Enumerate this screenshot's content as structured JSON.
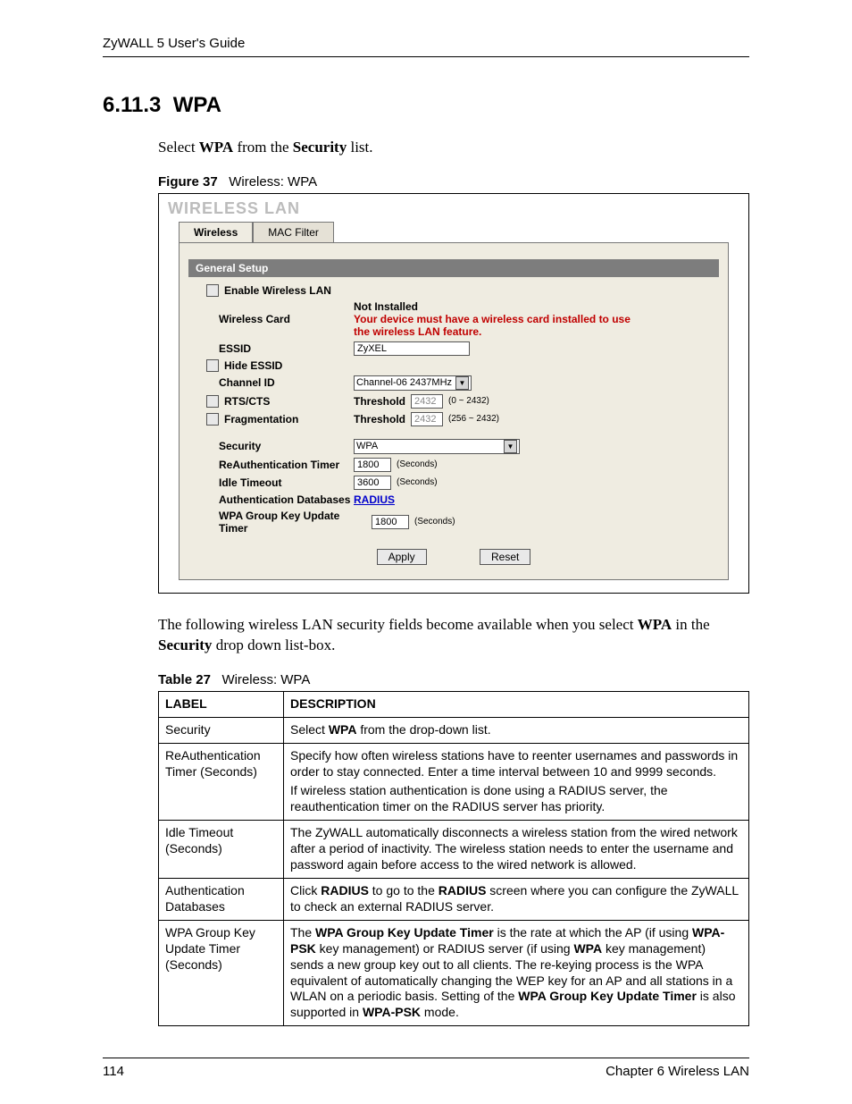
{
  "header": {
    "guide": "ZyWALL 5 User's Guide"
  },
  "section": {
    "number": "6.11.3",
    "title": "WPA"
  },
  "intro": {
    "pre": "Select ",
    "b1": "WPA",
    "mid": " from the ",
    "b2": "Security",
    "post": " list."
  },
  "figure": {
    "label": "Figure 37",
    "caption": "Wireless: WPA"
  },
  "panel": {
    "title": "WIRELESS LAN",
    "tabs": [
      "Wireless",
      "MAC Filter"
    ],
    "section_bar": "General Setup",
    "rows": {
      "enable_wlan": "Enable Wireless LAN",
      "wcard_label": "Wireless Card",
      "wcard_status": "Not Installed",
      "wcard_warn": "Your device must have a wireless card installed to use the wireless LAN feature.",
      "essid_label": "ESSID",
      "essid_value": "ZyXEL",
      "hide_essid": "Hide ESSID",
      "channel_label": "Channel ID",
      "channel_value": "Channel-06 2437MHz",
      "rtscts_label": "RTS/CTS",
      "threshold_label": "Threshold",
      "rts_value": "2432",
      "rts_range": "(0 ~ 2432)",
      "frag_label": "Fragmentation",
      "frag_value": "2432",
      "frag_range": "(256 ~ 2432)",
      "security_label": "Security",
      "security_value": "WPA",
      "reauth_label": "ReAuthentication Timer",
      "reauth_value": "1800",
      "seconds_unit": "(Seconds)",
      "idle_label": "Idle Timeout",
      "idle_value": "3600",
      "authdb_label": "Authentication Databases",
      "authdb_link": "RADIUS",
      "wpagroup_label": "WPA Group Key Update Timer",
      "wpagroup_value": "1800"
    },
    "buttons": {
      "apply": "Apply",
      "reset": "Reset"
    }
  },
  "para_after": {
    "p1": "The following wireless LAN security fields become available when you select ",
    "b1": "WPA",
    "p2": " in the ",
    "b2": "Security",
    "p3": " drop down list-box."
  },
  "table_caption": {
    "label": "Table 27",
    "caption": "Wireless: WPA"
  },
  "table": {
    "head": {
      "c1": "LABEL",
      "c2": "DESCRIPTION"
    },
    "rows": [
      {
        "label": "Security",
        "desc": [
          {
            "pre": "Select ",
            "b": "WPA",
            "post": " from the drop-down list."
          }
        ]
      },
      {
        "label": "ReAuthentication Timer (Seconds)",
        "desc": [
          {
            "text": "Specify how often wireless stations have to reenter usernames and passwords in order to stay connected. Enter a time interval between 10 and 9999 seconds."
          },
          {
            "text": "If wireless station authentication is done using a RADIUS server, the reauthentication timer on the RADIUS server has priority."
          }
        ]
      },
      {
        "label": "Idle Timeout (Seconds)",
        "desc": [
          {
            "text": "The ZyWALL automatically disconnects a wireless station from the wired network after a period of inactivity. The wireless station needs to enter the username and password again before access to the wired network is allowed."
          }
        ]
      },
      {
        "label": "Authentication Databases",
        "desc": [
          {
            "pre": "Click ",
            "b": "RADIUS",
            "mid": " to go to the ",
            "b2": "RADIUS",
            "post": " screen where you can configure the ZyWALL to check an external RADIUS server."
          }
        ]
      },
      {
        "label": "WPA Group Key Update Timer (Seconds)",
        "desc": [
          {
            "pre": "The ",
            "b": "WPA Group Key Update Timer",
            "mid": " is the rate at which the AP (if using ",
            "b2": "WPA-PSK",
            "mid2": " key management) or RADIUS server (if using ",
            "b3": "WPA",
            "mid3": " key management) sends a new group key out to all clients. The re-keying process is the WPA equivalent of automatically changing the WEP key for an AP and all stations in a WLAN on a periodic basis. Setting of the ",
            "b4": "WPA Group Key Update Timer",
            "mid4": " is also supported in ",
            "b5": "WPA-PSK",
            "post": " mode."
          }
        ]
      }
    ]
  },
  "footer": {
    "page": "114",
    "chapter": "Chapter 6 Wireless LAN"
  }
}
